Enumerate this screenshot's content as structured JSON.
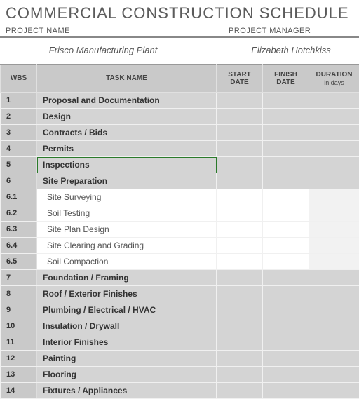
{
  "title": "COMMERCIAL CONSTRUCTION SCHEDULE",
  "meta": {
    "project_name_label": "PROJECT NAME",
    "project_manager_label": "PROJECT MANAGER",
    "project_name": "Frisco Manufacturing Plant",
    "project_manager": "Elizabeth Hotchkiss"
  },
  "headers": {
    "wbs": "WBS",
    "task": "TASK NAME",
    "start": "START DATE",
    "finish": "FINISH DATE",
    "duration": "DURATION",
    "duration_sub": "in days"
  },
  "rows": [
    {
      "wbs": "1",
      "name": "Proposal and Documentation",
      "type": "section"
    },
    {
      "wbs": "2",
      "name": "Design",
      "type": "section"
    },
    {
      "wbs": "3",
      "name": "Contracts / Bids",
      "type": "section"
    },
    {
      "wbs": "4",
      "name": "Permits",
      "type": "section"
    },
    {
      "wbs": "5",
      "name": "Inspections",
      "type": "section",
      "selected": true
    },
    {
      "wbs": "6",
      "name": "Site Preparation",
      "type": "section"
    },
    {
      "wbs": "6.1",
      "name": "Site Surveying",
      "type": "sub"
    },
    {
      "wbs": "6.2",
      "name": "Soil Testing",
      "type": "sub"
    },
    {
      "wbs": "6.3",
      "name": "Site Plan Design",
      "type": "sub"
    },
    {
      "wbs": "6.4",
      "name": "Site Clearing and Grading",
      "type": "sub"
    },
    {
      "wbs": "6.5",
      "name": "Soil Compaction",
      "type": "sub"
    },
    {
      "wbs": "7",
      "name": "Foundation / Framing",
      "type": "section"
    },
    {
      "wbs": "8",
      "name": "Roof / Exterior Finishes",
      "type": "section"
    },
    {
      "wbs": "9",
      "name": "Plumbing / Electrical / HVAC",
      "type": "section"
    },
    {
      "wbs": "10",
      "name": "Insulation / Drywall",
      "type": "section"
    },
    {
      "wbs": "11",
      "name": "Interior Finishes",
      "type": "section"
    },
    {
      "wbs": "12",
      "name": "Painting",
      "type": "section"
    },
    {
      "wbs": "13",
      "name": "Flooring",
      "type": "section"
    },
    {
      "wbs": "14",
      "name": "Fixtures / Appliances",
      "type": "section"
    }
  ]
}
